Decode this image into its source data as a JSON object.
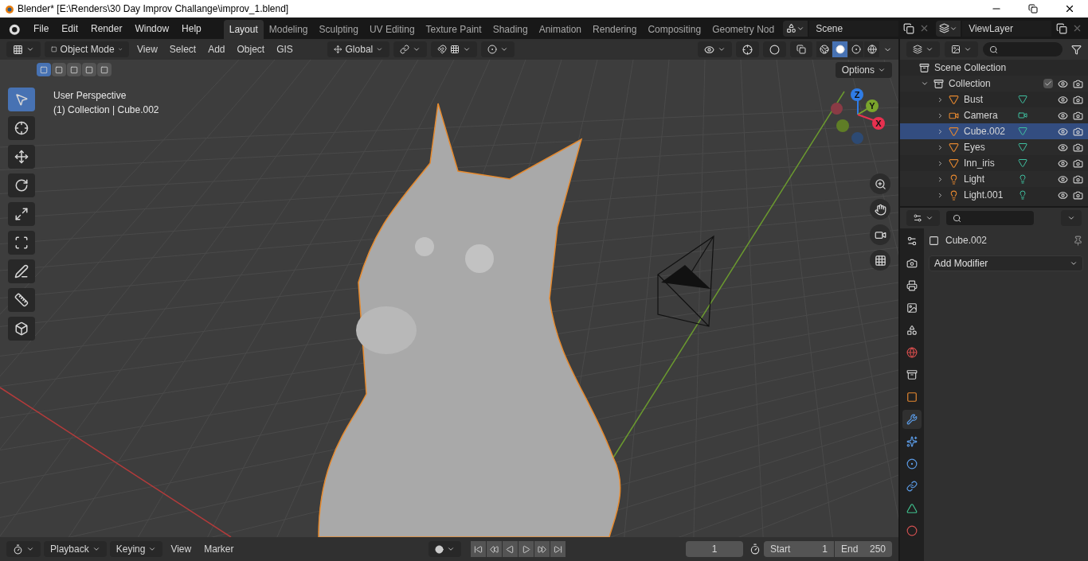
{
  "window": {
    "title": "Blender* [E:\\Renders\\30 Day Improv Challange\\improv_1.blend]"
  },
  "menu": [
    "File",
    "Edit",
    "Render",
    "Window",
    "Help"
  ],
  "workspaces": [
    {
      "label": "Layout",
      "selected": true
    },
    {
      "label": "Modeling",
      "selected": false
    },
    {
      "label": "Sculpting",
      "selected": false
    },
    {
      "label": "UV Editing",
      "selected": false
    },
    {
      "label": "Texture Paint",
      "selected": false
    },
    {
      "label": "Shading",
      "selected": false
    },
    {
      "label": "Animation",
      "selected": false
    },
    {
      "label": "Rendering",
      "selected": false
    },
    {
      "label": "Compositing",
      "selected": false
    },
    {
      "label": "Geometry Nod",
      "selected": false
    }
  ],
  "scene": "Scene",
  "view_layer": "ViewLayer",
  "viewport": {
    "mode": "Object Mode",
    "menus": [
      "View",
      "Select",
      "Add",
      "Object",
      "GIS"
    ],
    "orientation": "Global",
    "options": "Options",
    "overlay_text": [
      "User Perspective",
      "(1) Collection | Cube.002"
    ],
    "select_modes": [
      {
        "selected": true
      },
      {
        "selected": false
      },
      {
        "selected": false
      },
      {
        "selected": false
      },
      {
        "selected": false
      }
    ],
    "shading": [
      {
        "kind": "wireframe",
        "selected": false
      },
      {
        "kind": "solid",
        "selected": true
      },
      {
        "kind": "material",
        "selected": false
      },
      {
        "kind": "rendered",
        "selected": false
      }
    ],
    "tools": [
      {
        "kind": "select",
        "selected": true
      },
      {
        "kind": "cursor",
        "selected": false
      },
      {
        "kind": "move",
        "selected": false
      },
      {
        "kind": "rotate",
        "selected": false
      },
      {
        "kind": "scale",
        "selected": false
      },
      {
        "kind": "transform",
        "selected": false
      },
      {
        "kind": "annotate",
        "selected": false
      },
      {
        "kind": "measure",
        "selected": false
      },
      {
        "kind": "add-cube",
        "selected": false
      }
    ],
    "gizmo": [
      {
        "label": "Z",
        "color": "#2f7ce6"
      },
      {
        "label": "Y",
        "color": "#7aa52c"
      },
      {
        "label": "X",
        "color": "#e8304f"
      }
    ]
  },
  "outliner": {
    "scene_collection": "Scene Collection",
    "collection": {
      "name": "Collection",
      "expanded": true,
      "checked": true
    },
    "items": [
      {
        "name": "Bust",
        "kind": "mesh",
        "selected": false
      },
      {
        "name": "Camera",
        "kind": "camera",
        "selected": false
      },
      {
        "name": "Cube.002",
        "kind": "mesh",
        "selected": true
      },
      {
        "name": "Eyes",
        "kind": "mesh",
        "selected": false
      },
      {
        "name": "Inn_iris",
        "kind": "mesh",
        "selected": false
      },
      {
        "name": "Light",
        "kind": "light",
        "selected": false
      },
      {
        "name": "Light.001",
        "kind": "light",
        "selected": false
      }
    ]
  },
  "properties": {
    "object": "Cube.002",
    "add_modifier": "Add Modifier",
    "tabs": [
      {
        "kind": "tool",
        "selected": false
      },
      {
        "kind": "render",
        "selected": false
      },
      {
        "kind": "output",
        "selected": false
      },
      {
        "kind": "view-layer",
        "selected": false
      },
      {
        "kind": "scene",
        "selected": false
      },
      {
        "kind": "world",
        "selected": false
      },
      {
        "kind": "collection",
        "selected": false
      },
      {
        "kind": "object",
        "selected": false
      },
      {
        "kind": "modifier",
        "selected": true
      },
      {
        "kind": "particles",
        "selected": false
      },
      {
        "kind": "physics",
        "selected": false
      },
      {
        "kind": "constraints",
        "selected": false
      },
      {
        "kind": "data",
        "selected": false
      },
      {
        "kind": "material",
        "selected": false
      }
    ]
  },
  "timeline": {
    "menus": [
      "Playback",
      "Keying",
      "View",
      "Marker"
    ],
    "current_frame": "1",
    "start_label": "Start",
    "start": "1",
    "end_label": "End",
    "end": "250"
  }
}
